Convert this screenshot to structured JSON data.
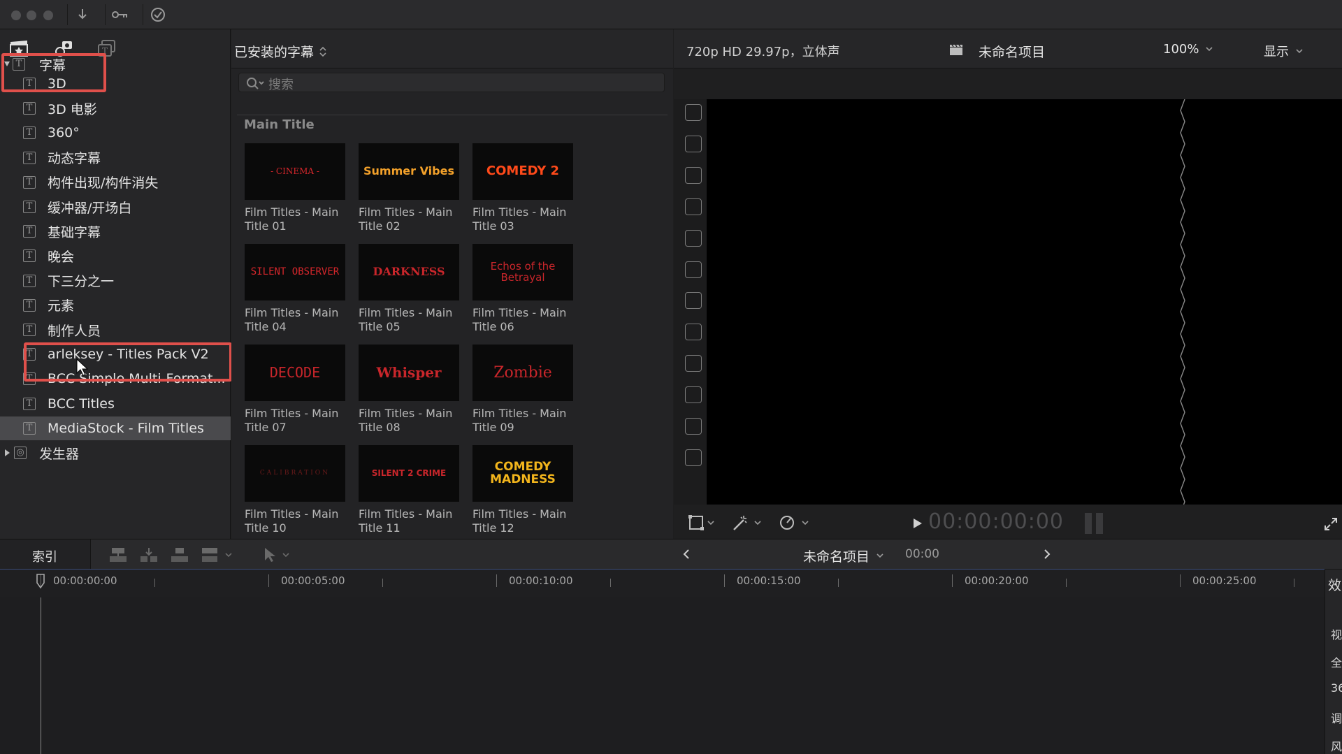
{
  "sidebar": {
    "root_label": "字幕",
    "items": [
      "3D",
      "3D 电影",
      "360°",
      "动态字幕",
      "构件出现/构件消失",
      "缓冲器/开场白",
      "基础字幕",
      "晚会",
      "下三分之一",
      "元素",
      "制作人员",
      "arleksey - Titles Pack V2",
      "BCC Simple Multi-Format...",
      "BCC Titles",
      "MediaStock - Film Titles"
    ],
    "generators_label": "发生器"
  },
  "browser": {
    "category_menu": "已安装的字幕",
    "search_placeholder": "搜索",
    "section_title": "Main Title",
    "items": [
      {
        "caption": "Film Titles - Main Title 01",
        "thumb_text": "- CINEMA -"
      },
      {
        "caption": "Film Titles - Main Title 02",
        "thumb_text": "Summer Vibes"
      },
      {
        "caption": "Film Titles - Main Title 03",
        "thumb_text": "COMEDY 2"
      },
      {
        "caption": "Film Titles - Main Title 04",
        "thumb_text": "SILENT OBSERVER"
      },
      {
        "caption": "Film Titles - Main Title 05",
        "thumb_text": "DARKNESS"
      },
      {
        "caption": "Film Titles - Main Title 06",
        "thumb_text": "Echos of the Betrayal"
      },
      {
        "caption": "Film Titles - Main Title 07",
        "thumb_text": "DECODE"
      },
      {
        "caption": "Film Titles - Main Title 08",
        "thumb_text": "Whisper"
      },
      {
        "caption": "Film Titles - Main Title 09",
        "thumb_text": "Zombie"
      },
      {
        "caption": "Film Titles - Main Title 10",
        "thumb_text": "CALIBRATION"
      },
      {
        "caption": "Film Titles - Main Title 11",
        "thumb_text": "SILENT 2 CRIME"
      },
      {
        "caption": "Film Titles - Main Title 12",
        "thumb_text": "COMEDY MADNESS"
      }
    ]
  },
  "viewer": {
    "format": "720p HD 29.97p，立体声",
    "project_name": "未命名项目",
    "zoom": "100%",
    "display_menu": "显示",
    "timecode": "00:00:00:00"
  },
  "timeline": {
    "index_label": "索引",
    "project_name": "未命名项目",
    "duration": "00:00",
    "ruler_labels": [
      "00:00:00:00",
      "00:00:05:00",
      "00:00:10:00",
      "00:00:15:00",
      "00:00:20:00",
      "00:00:25:00"
    ]
  },
  "inspector": {
    "tab_label": "效",
    "items": [
      "视",
      "全",
      "36",
      "调",
      "风"
    ]
  },
  "colors": {
    "highlight": "#e0504b",
    "selection": "#4a4a4d"
  }
}
